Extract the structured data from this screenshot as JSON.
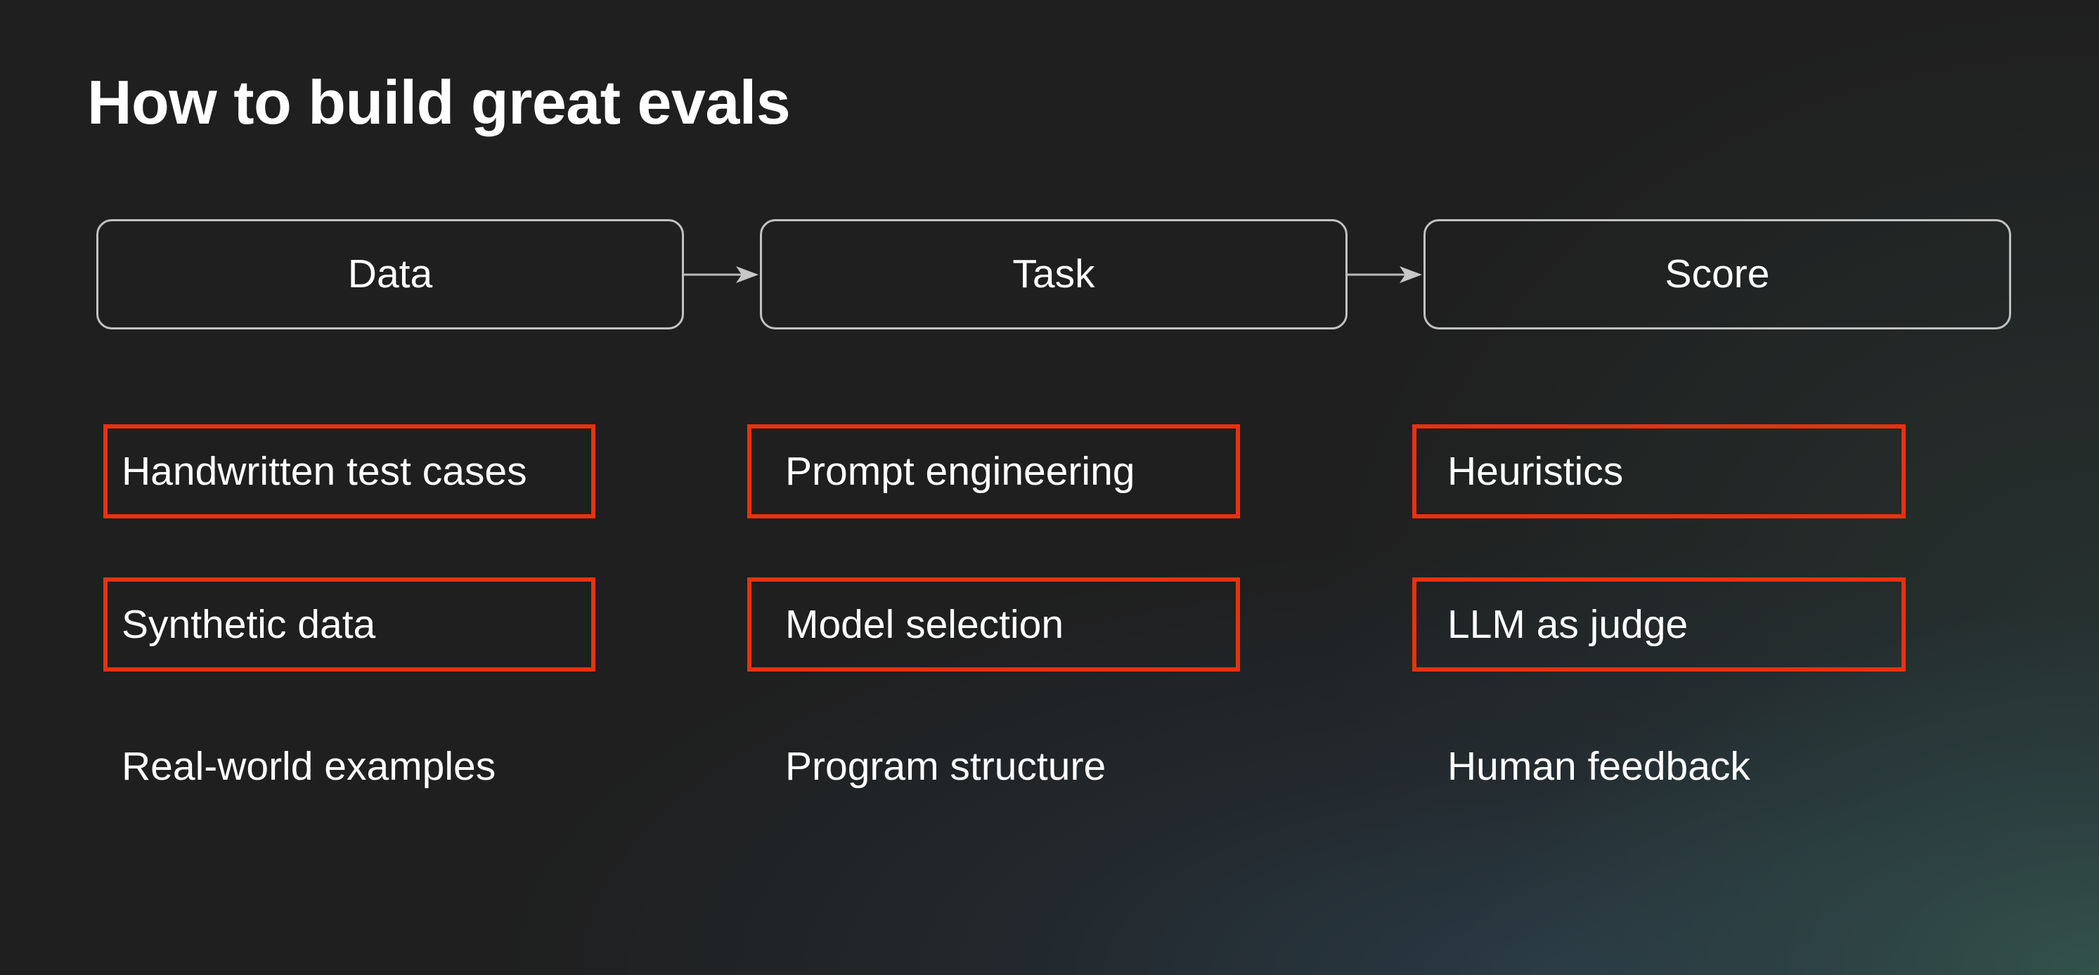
{
  "slide": {
    "title": "How to build great evals"
  },
  "pipeline": {
    "stages": [
      {
        "label": "Data"
      },
      {
        "label": "Task"
      },
      {
        "label": "Score"
      }
    ],
    "arrow_color": "#b9b9b9",
    "stage_border_color": "#c2c2c2"
  },
  "columns": [
    {
      "stage": "Data",
      "items": [
        {
          "label": "Handwritten test cases",
          "highlighted": true
        },
        {
          "label": "Synthetic data",
          "highlighted": true
        },
        {
          "label": "Real-world examples",
          "highlighted": false
        }
      ]
    },
    {
      "stage": "Task",
      "items": [
        {
          "label": "Prompt engineering",
          "highlighted": true
        },
        {
          "label": "Model selection",
          "highlighted": true
        },
        {
          "label": "Program structure",
          "highlighted": false
        }
      ]
    },
    {
      "stage": "Score",
      "items": [
        {
          "label": "Heuristics",
          "highlighted": true
        },
        {
          "label": "LLM as judge",
          "highlighted": true
        },
        {
          "label": "Human feedback",
          "highlighted": false
        }
      ]
    }
  ],
  "colors": {
    "background": "#1f1f1f",
    "highlight_border": "#e8320f",
    "text": "#ffffff",
    "glow": "#325048"
  }
}
